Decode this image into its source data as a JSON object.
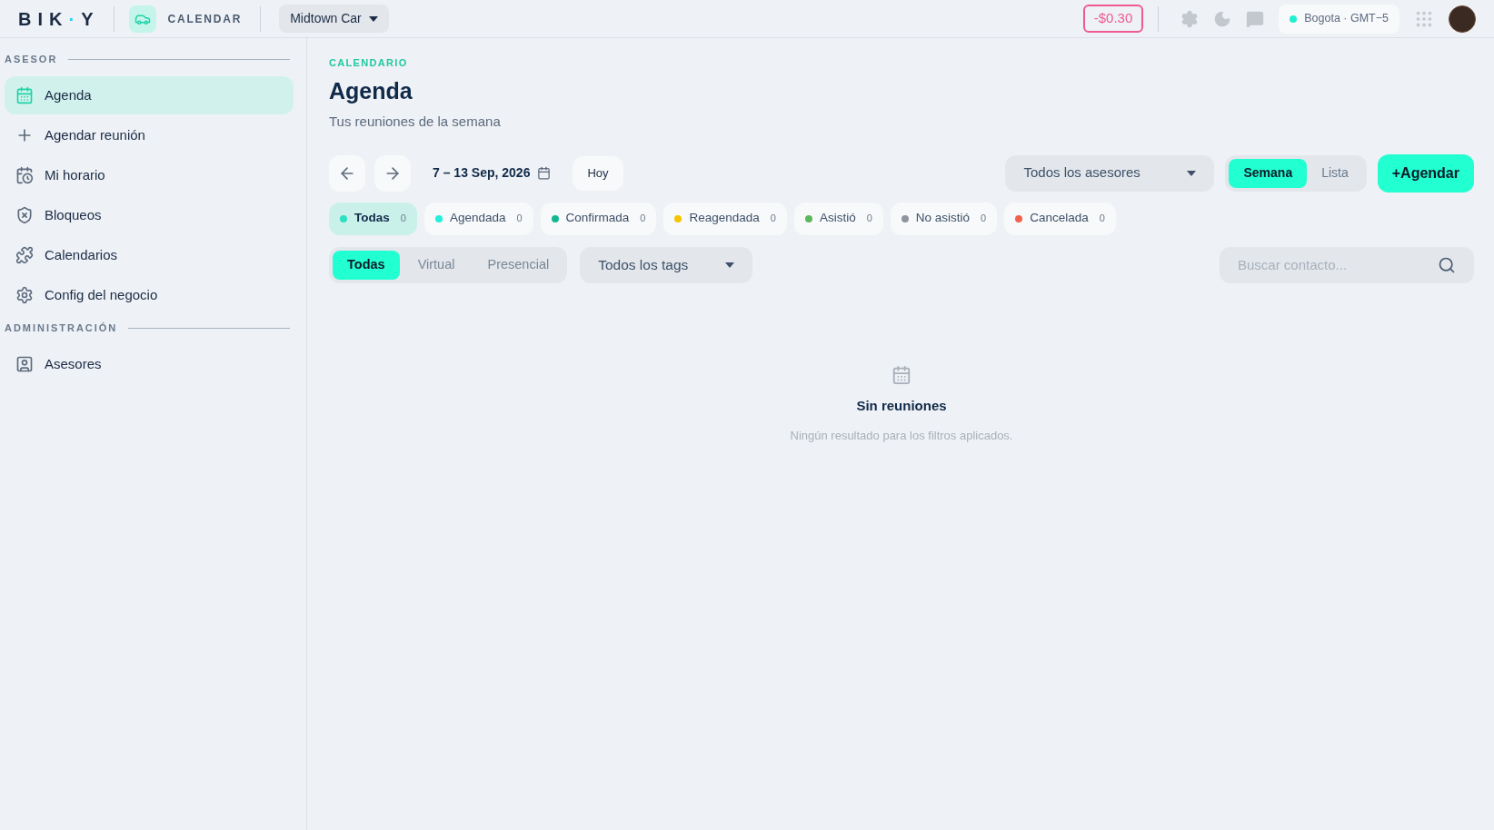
{
  "topbar": {
    "logo": [
      {
        "text": "BIK",
        "accent": false
      },
      {
        "text": "·",
        "accent": true
      },
      {
        "text": "Y",
        "accent": false
      }
    ],
    "app_label": "CALENDAR",
    "business": "Midtown Car",
    "balance": "-$0.30",
    "timezone": "Bogota · GMT−5"
  },
  "sidebar": {
    "sections": [
      {
        "title": "ASESOR",
        "items": [
          {
            "label": "Agenda",
            "selected": true
          },
          {
            "label": "Agendar reunión",
            "selected": false
          },
          {
            "label": "Mi horario",
            "selected": false
          },
          {
            "label": "Bloqueos",
            "selected": false
          },
          {
            "label": "Calendarios",
            "selected": false
          },
          {
            "label": "Config del negocio",
            "selected": false
          }
        ]
      },
      {
        "title": "ADMINISTRACIÓN",
        "items": [
          {
            "label": "Asesores",
            "selected": false
          }
        ]
      }
    ]
  },
  "header": {
    "eyebrow": "CALENDARIO",
    "title": "Agenda",
    "subtitle": "Tus reuniones de la semana"
  },
  "toolbar": {
    "date_range": "7 – 13 Sep, 2026",
    "today": "Hoy",
    "advisor_select": "Todos los asesores",
    "views": [
      {
        "label": "Semana",
        "selected": true
      },
      {
        "label": "Lista",
        "selected": false
      }
    ],
    "add_button": "+Agendar"
  },
  "status_filters": [
    {
      "label": "Todas",
      "count": "0",
      "color": "#2de0c0",
      "selected": true
    },
    {
      "label": "Agendada",
      "count": "0",
      "color": "#22f0d8",
      "selected": false
    },
    {
      "label": "Confirmada",
      "count": "0",
      "color": "#14b890",
      "selected": false
    },
    {
      "label": "Reagendada",
      "count": "0",
      "color": "#f5c400",
      "selected": false
    },
    {
      "label": "Asistió",
      "count": "0",
      "color": "#5cb85c",
      "selected": false
    },
    {
      "label": "No asistió",
      "count": "0",
      "color": "#8e959c",
      "selected": false
    },
    {
      "label": "Cancelada",
      "count": "0",
      "color": "#f0624d",
      "selected": false
    }
  ],
  "mode_filters": [
    {
      "label": "Todas",
      "selected": true
    },
    {
      "label": "Virtual",
      "selected": false
    },
    {
      "label": "Presencial",
      "selected": false
    }
  ],
  "tags_select": "Todos los tags",
  "search": {
    "placeholder": "Buscar contacto..."
  },
  "empty_state": {
    "title": "Sin reuniones",
    "message": "Ningún resultado para los filtros aplicados."
  }
}
